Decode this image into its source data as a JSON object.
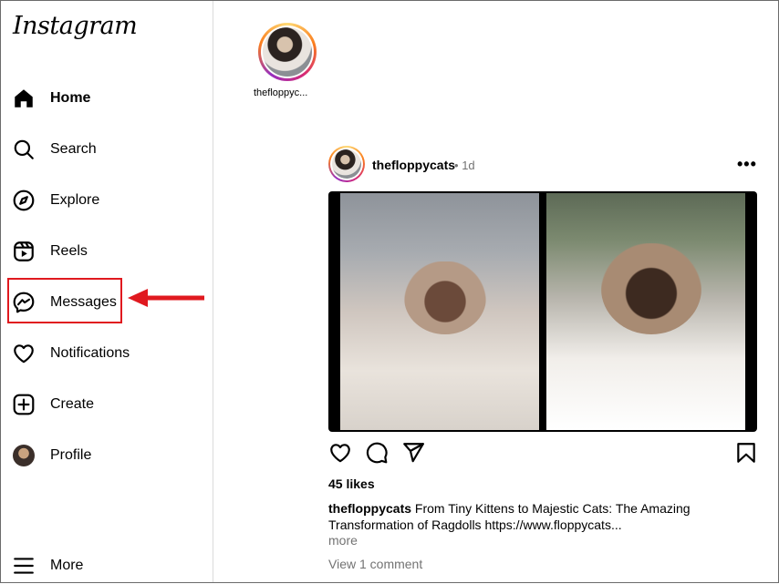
{
  "app": {
    "logo_text": "Instagram"
  },
  "sidebar": {
    "items": [
      {
        "label": "Home",
        "icon": "home-icon"
      },
      {
        "label": "Search",
        "icon": "search-icon"
      },
      {
        "label": "Explore",
        "icon": "compass-icon"
      },
      {
        "label": "Reels",
        "icon": "reels-icon"
      },
      {
        "label": "Messages",
        "icon": "messenger-icon"
      },
      {
        "label": "Notifications",
        "icon": "heart-icon"
      },
      {
        "label": "Create",
        "icon": "plus-square-icon"
      },
      {
        "label": "Profile",
        "icon": "avatar"
      }
    ],
    "more_label": "More"
  },
  "annotation": {
    "highlight_color": "#e0191f"
  },
  "stories": [
    {
      "username": "thefloppyc..."
    }
  ],
  "post": {
    "username": "thefloppycats",
    "separator": "•",
    "time": "1d",
    "more": "•••",
    "likes": "45 likes",
    "caption_user": "thefloppycats",
    "caption_text": "From Tiny Kittens to Majestic Cats: The Amazing Transformation of Ragdolls https://www.floppycats...",
    "more_label": "more",
    "view_comments": "View 1 comment"
  }
}
